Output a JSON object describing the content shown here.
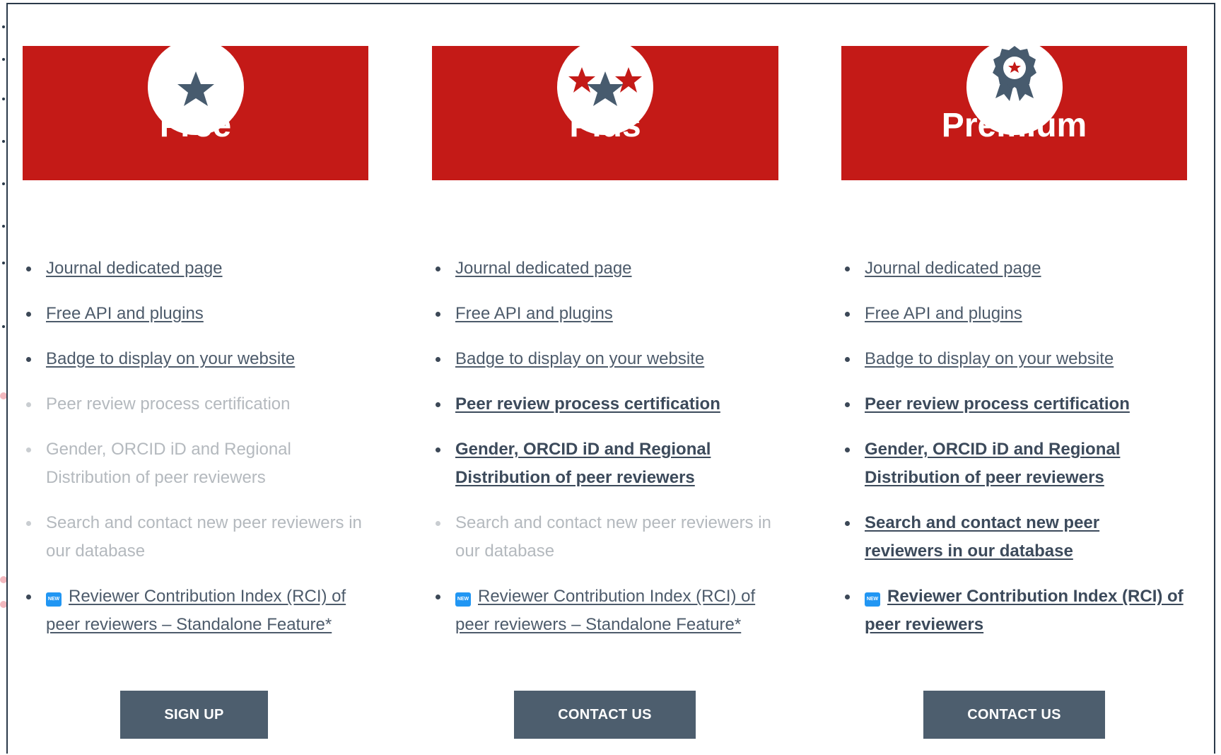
{
  "colors": {
    "header_red": "#c41a17",
    "button_slate": "#4d5e6e",
    "icon_slate": "#475b6e",
    "new_badge_blue": "#2196f3"
  },
  "plans": [
    {
      "name": "Free",
      "icon": "single-star-icon",
      "button_label": "SIGN UP",
      "features": [
        {
          "text": "Journal dedicated page",
          "state": "link"
        },
        {
          "text": "Free API and plugins",
          "state": "link"
        },
        {
          "text": "Badge to display on your website",
          "state": "link"
        },
        {
          "text": "Peer review process certification",
          "state": "disabled"
        },
        {
          "text": "Gender, ORCID iD and Regional Distribution of peer reviewers",
          "state": "disabled"
        },
        {
          "text": "Search and contact new peer reviewers in our database",
          "state": "disabled"
        },
        {
          "text": "Reviewer Contribution Index (RCI) of peer reviewers – Standalone Feature*",
          "state": "link",
          "badge": "NEW"
        }
      ]
    },
    {
      "name": "Plus",
      "icon": "three-stars-icon",
      "button_label": "CONTACT US",
      "features": [
        {
          "text": "Journal dedicated page",
          "state": "link"
        },
        {
          "text": "Free API and plugins",
          "state": "link"
        },
        {
          "text": "Badge to display on your website",
          "state": "link"
        },
        {
          "text": "Peer review process certification",
          "state": "bold"
        },
        {
          "text": "Gender, ORCID iD and Regional Distribution of peer reviewers",
          "state": "bold"
        },
        {
          "text": "Search and contact new peer reviewers in our database",
          "state": "disabled"
        },
        {
          "text": "Reviewer Contribution Index (RCI) of peer reviewers – Standalone Feature*",
          "state": "link",
          "badge": "NEW"
        }
      ]
    },
    {
      "name": "Premium",
      "icon": "award-rosette-icon",
      "button_label": "CONTACT US",
      "features": [
        {
          "text": "Journal dedicated page",
          "state": "link"
        },
        {
          "text": "Free API and plugins",
          "state": "link"
        },
        {
          "text": "Badge to display on your website",
          "state": "link"
        },
        {
          "text": "Peer review process certification",
          "state": "bold"
        },
        {
          "text": "Gender, ORCID iD and Regional Distribution of peer reviewers",
          "state": "bold"
        },
        {
          "text": "Search and contact new peer reviewers in our database",
          "state": "bold"
        },
        {
          "text": "Reviewer Contribution Index (RCI) of peer reviewers",
          "state": "bold",
          "badge": "NEW"
        }
      ]
    }
  ]
}
